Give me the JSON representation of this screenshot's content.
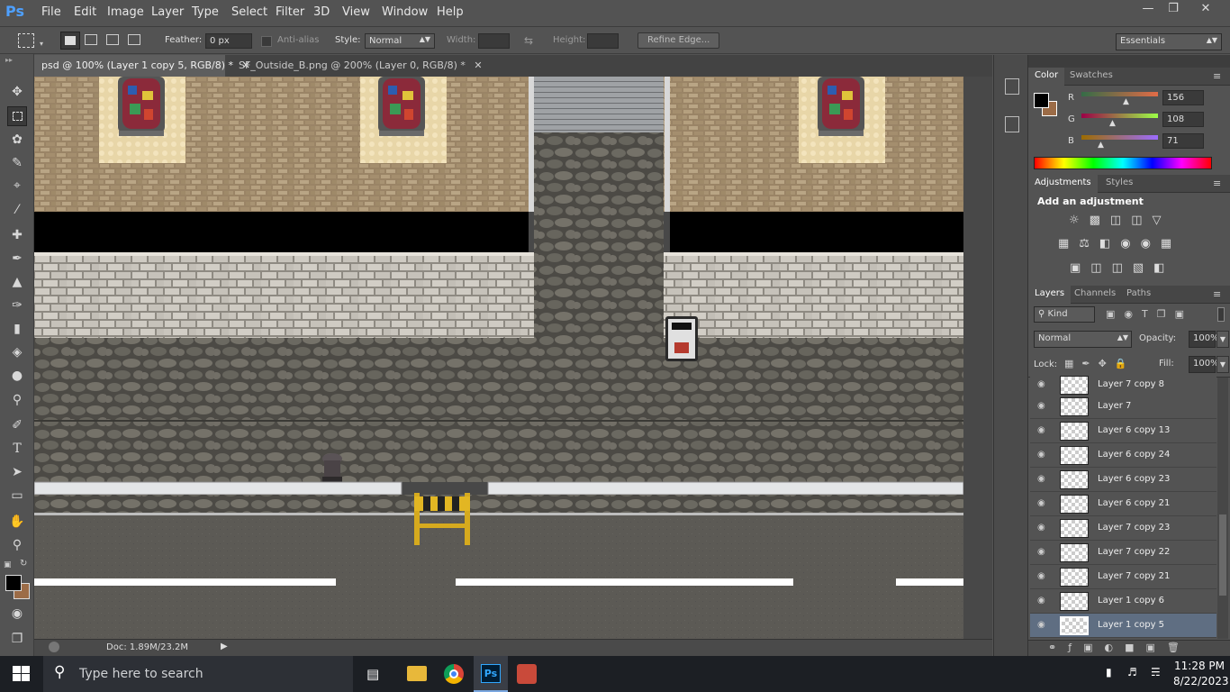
{
  "app": {
    "logo": "Ps",
    "menu": [
      "File",
      "Edit",
      "Image",
      "Layer",
      "Type",
      "Select",
      "Filter",
      "3D",
      "View",
      "Window",
      "Help"
    ]
  },
  "options": {
    "feather_label": "Feather:",
    "feather_value": "0 px",
    "antialias_label": "Anti-alias",
    "style_label": "Style:",
    "style_value": "Normal",
    "width_label": "Width:",
    "height_label": "Height:",
    "refine_label": "Refine Edge...",
    "workspace": "Essentials"
  },
  "tabs": [
    {
      "label": "psd @ 100% (Layer 1 copy 5, RGB/8) *"
    },
    {
      "label": "SF_Outside_B.png @ 200% (Layer 0, RGB/8) *"
    }
  ],
  "status": {
    "doc": "Doc: 1.89M/23.2M"
  },
  "color_panel": {
    "tabs": [
      "Color",
      "Swatches"
    ],
    "r_label": "R",
    "g_label": "G",
    "b_label": "B",
    "r": "156",
    "g": "108",
    "b": "71",
    "fg": "#000000",
    "bg": "#9c6c47"
  },
  "adjustments": {
    "tabs": [
      "Adjustments",
      "Styles"
    ],
    "title": "Add an adjustment"
  },
  "layers_panel": {
    "tabs": [
      "Layers",
      "Channels",
      "Paths"
    ],
    "filter": "Kind",
    "blend": "Normal",
    "opacity_label": "Opacity:",
    "opacity": "100%",
    "lock_label": "Lock:",
    "fill_label": "Fill:",
    "fill": "100%",
    "layers": [
      "Layer 7 copy 8",
      "Layer 7",
      "Layer 6 copy 13",
      "Layer 6 copy 24",
      "Layer 6 copy 23",
      "Layer 6 copy 21",
      "Layer 7 copy 23",
      "Layer 7 copy 22",
      "Layer 7 copy 21",
      "Layer 1 copy 6",
      "Layer 1 copy 5"
    ]
  },
  "taskbar": {
    "search": "Type here to search",
    "time": "11:28 PM",
    "date": "8/22/2023"
  }
}
